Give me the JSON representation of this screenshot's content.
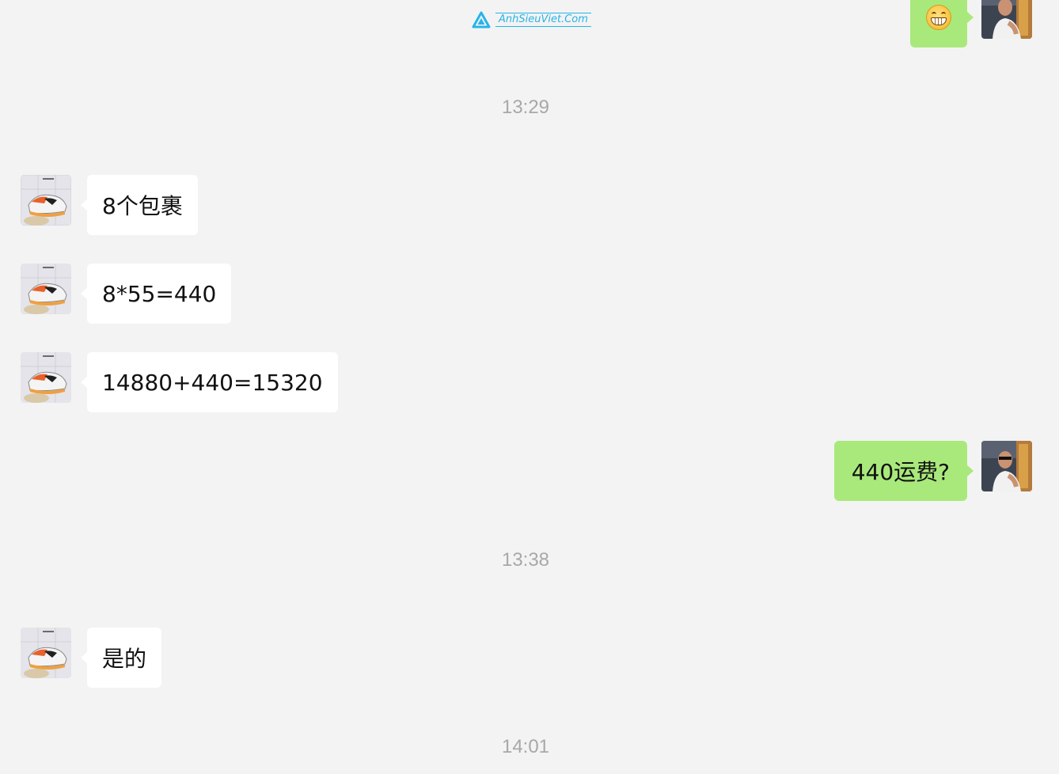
{
  "watermark": {
    "text": "AnhSieuViet.Com",
    "icon": "triangle-logo-icon"
  },
  "colors": {
    "background": "#f3f3f3",
    "incoming_bubble": "#ffffff",
    "outgoing_bubble": "#a9e97b",
    "timestamp_text": "#a8a8a8",
    "watermark": "#27b4e8"
  },
  "chat": {
    "top_message": {
      "sender": "self",
      "emoji": "grinning-face-icon"
    },
    "timestamps": [
      "13:29",
      "13:38",
      "14:01"
    ],
    "messages": [
      {
        "sender": "contact",
        "text": "8个包裹"
      },
      {
        "sender": "contact",
        "text": "8*55=440"
      },
      {
        "sender": "contact",
        "text": "14880+440=15320"
      },
      {
        "sender": "self",
        "text": "440运费?"
      },
      {
        "sender": "contact",
        "text": "是的"
      }
    ],
    "avatars": {
      "contact": "sneaker-photo-avatar",
      "self": "man-photo-avatar"
    }
  }
}
